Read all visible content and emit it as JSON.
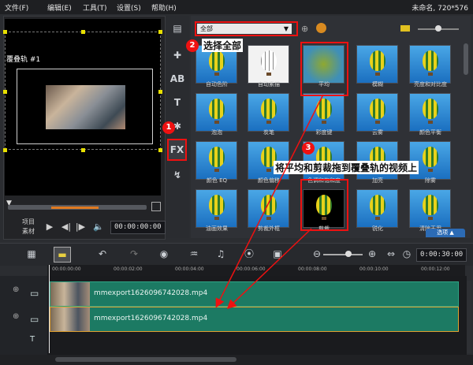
{
  "menu": {
    "items": [
      "文件(F)",
      "编辑(E)",
      "工具(T)",
      "设置(S)",
      "帮助(H)"
    ],
    "project_info": "未命名, 720*576"
  },
  "preview": {
    "overlay_track_label": "覆叠轨 #1",
    "mode_project": "项目",
    "mode_clip": "素材",
    "timecode": "00:00:00:00"
  },
  "library": {
    "category_dropdown": "全部",
    "thumbnails": [
      {
        "label": "自动色阶"
      },
      {
        "label": "自动素描"
      },
      {
        "label": "平均"
      },
      {
        "label": "模糊"
      },
      {
        "label": "亮度和对比度"
      },
      {
        "label": "泡泡"
      },
      {
        "label": "炭笔"
      },
      {
        "label": "彩度键"
      },
      {
        "label": "云雾"
      },
      {
        "label": "颜色平衡"
      },
      {
        "label": "颜色 EQ"
      },
      {
        "label": "颜色偏移"
      },
      {
        "label": "色调和饱和度"
      },
      {
        "label": "加亮"
      },
      {
        "label": "除雾"
      },
      {
        "label": "油画效果"
      },
      {
        "label": "剪裁外框"
      },
      {
        "label": "剪裁"
      },
      {
        "label": "锐化"
      },
      {
        "label": "清除无用"
      }
    ],
    "options_label": "选项"
  },
  "annotations": {
    "step1": "1",
    "step2": "2",
    "step2_text": "选择全部",
    "step3": "3",
    "step3_text": "将平均和剪裁拖到覆叠轨的视频上",
    "highlight_color": "#ee1111"
  },
  "timeline": {
    "timecode": "0:00:30:00",
    "ruler": [
      "00:00:00:00",
      "00:00:02:00",
      "00:00:04:00",
      "00:00:06:00",
      "00:00:08:00",
      "00:00:10:00",
      "00:00:12:00"
    ],
    "video_clip_name": "mmexport1626096742028.mp4",
    "overlay_clip_name": "mmexport1626096742028.mp4",
    "clip_color": "#1c7a63"
  }
}
